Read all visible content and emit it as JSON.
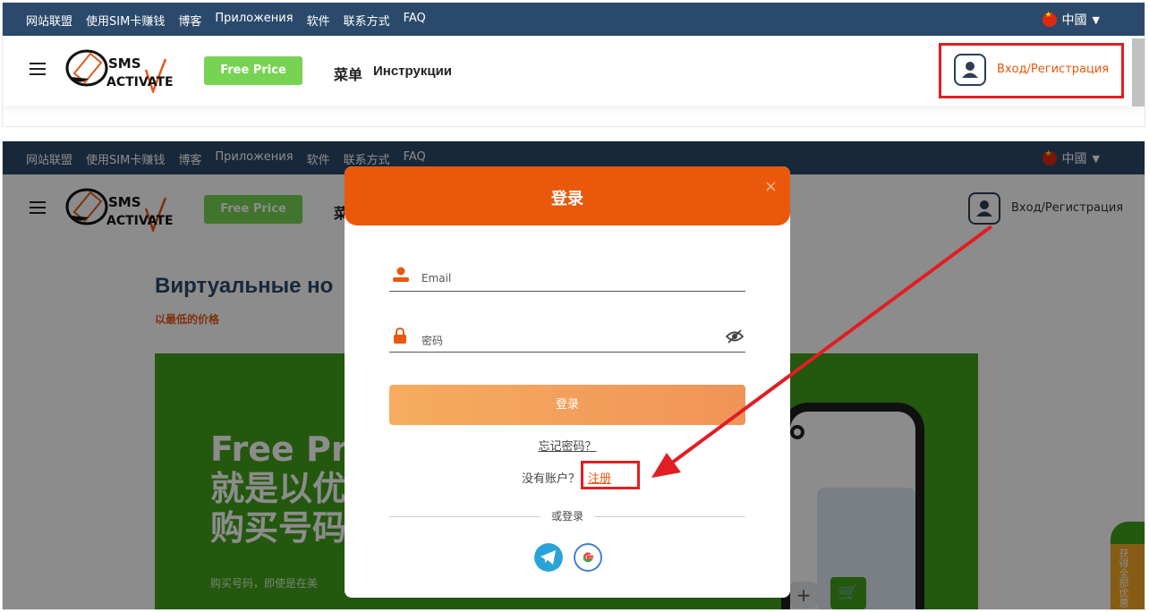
{
  "topbar": {
    "links": [
      "网站联盟",
      "使用SIM卡赚钱",
      "博客",
      "Приложения",
      "软件",
      "联系方式",
      "FAQ"
    ],
    "language": "中國"
  },
  "header": {
    "logo_top": "SMS",
    "logo_bottom": "ACTIVATE",
    "free_price": "Free Price",
    "menu": "菜单",
    "instructions": "Инструкции",
    "login_register": "Вход/Регистрация"
  },
  "page": {
    "title": "Виртуальные но",
    "subtitle": "以最低的价格",
    "hero_title_lines": [
      "Free Pr",
      "就是以优",
      "购买号码"
    ],
    "hero_desc": "购买号码，即使是在美",
    "side_tab": "获得全部优惠"
  },
  "modal": {
    "title": "登录",
    "close": "×",
    "email_placeholder": "Email",
    "password_placeholder": "密码",
    "submit": "登录",
    "forgot": "忘记密码？",
    "no_account": "没有账户？",
    "register": "注册",
    "or_login": "或登录"
  },
  "colors": {
    "topbar": "#2b4a6b",
    "accent": "#ea580c",
    "free_price_btn": "#77d352",
    "highlight": "#e01e23"
  }
}
